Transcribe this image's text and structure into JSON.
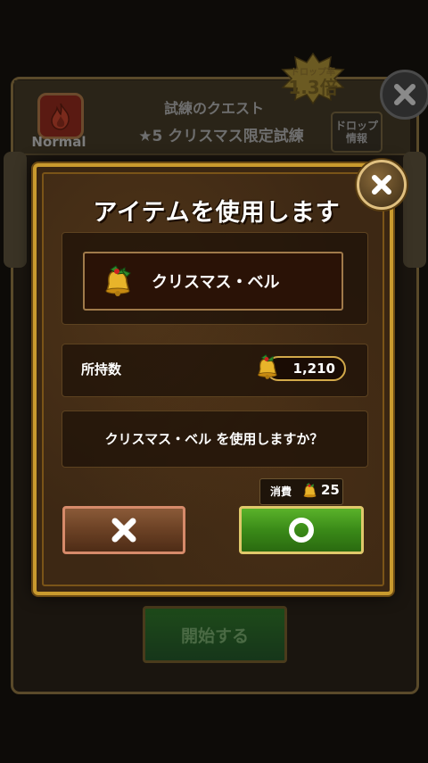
{
  "background": {
    "difficulty_label": "Normal",
    "quest_type": "試練のクエスト",
    "quest_name": "★5 クリスマス限定試練",
    "drop_rate_title": "ドロップ率",
    "drop_rate_value": "1.3倍",
    "drop_info_line1": "ドロップ",
    "drop_info_line2": "情報",
    "start_button_label": "開始する"
  },
  "dialog": {
    "title": "アイテムを使用します",
    "item_name": "クリスマス・ベル",
    "owned_label": "所持数",
    "owned_count": "1,210",
    "confirm_message": "クリスマス・ベル を使用しますか？",
    "cost_label": "消費",
    "cost_value": "25",
    "cancel_icon": "x-icon",
    "confirm_icon": "circle-icon"
  },
  "colors": {
    "modal_border": "#c99a2e",
    "confirm_green": "#3a8a18",
    "cancel_brown": "#6e4326"
  }
}
